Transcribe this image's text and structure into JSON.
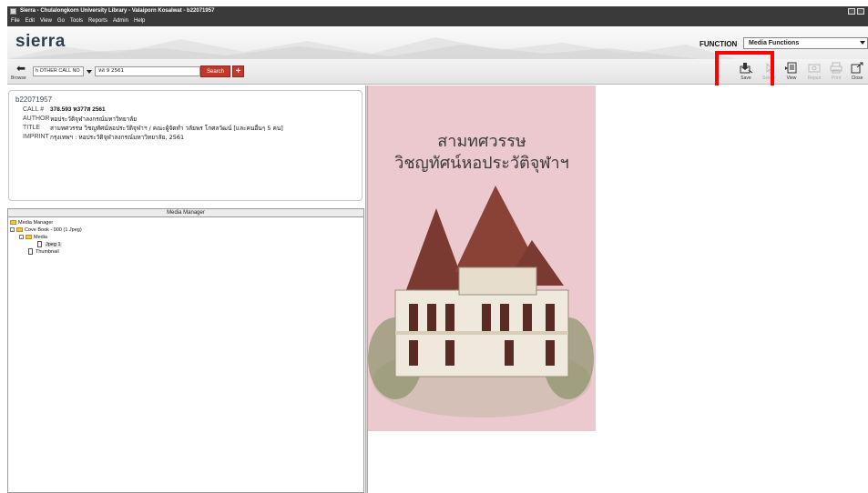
{
  "window": {
    "title": "Sierra - Chulalongkorn University Library - Valaiporn Kosalwat - b22071957"
  },
  "menu": [
    "File",
    "Edit",
    "View",
    "Go",
    "Tools",
    "Reports",
    "Admin",
    "Help"
  ],
  "header": {
    "logo": "sierra",
    "function_label": "FUNCTION",
    "function_value": "Media Functions"
  },
  "search": {
    "browse_label": "Browse",
    "type": "h OTHER CALL NO",
    "query": "หส 9 2561",
    "search_label": "Search",
    "add_label": "+"
  },
  "toolbar": {
    "save": "Save",
    "select": "Select",
    "view": "View",
    "repair": "Repair",
    "print": "Print",
    "close": "Close"
  },
  "record": {
    "id": "b22071957",
    "call_label": "CALL #",
    "call_value": "378.593 ห377ส 2561",
    "author_label": "AUTHOR",
    "author_value": "หอประวัติจุฬาลงกรณ์มหาวิทยาลัย",
    "title_label": "TITLE",
    "title_value": "สามทศวรรษ วิชญทัศน์หอประวัติจุฬาฯ / คณะผู้จัดทำ วลัยพร โกศลวัฒน์ [และคนอื่นๆ 5 คน]",
    "imprint_label": "IMPRINT",
    "imprint_value": "กรุงเทพฯ : หอประวัติจุฬาลงกรณ์มหาวิทยาลัย, 2561"
  },
  "media_manager": {
    "header": "Media Manager",
    "root": "Media Manager",
    "cover": "Cove Book - 000 (1 Jpeg)",
    "media": "Media",
    "jpeg": "Jpeg 1",
    "thumbnail": "Thumbnail"
  },
  "cover": {
    "line1": "สามทศวรรษ",
    "line2": "วิชญทัศน์หอประวัติจุฬาฯ"
  },
  "colors": {
    "accent": "#c0392b",
    "highlight": "#ff0000",
    "cover_bg": "#ecc9cf",
    "titlebar": "#3a3a3a"
  }
}
